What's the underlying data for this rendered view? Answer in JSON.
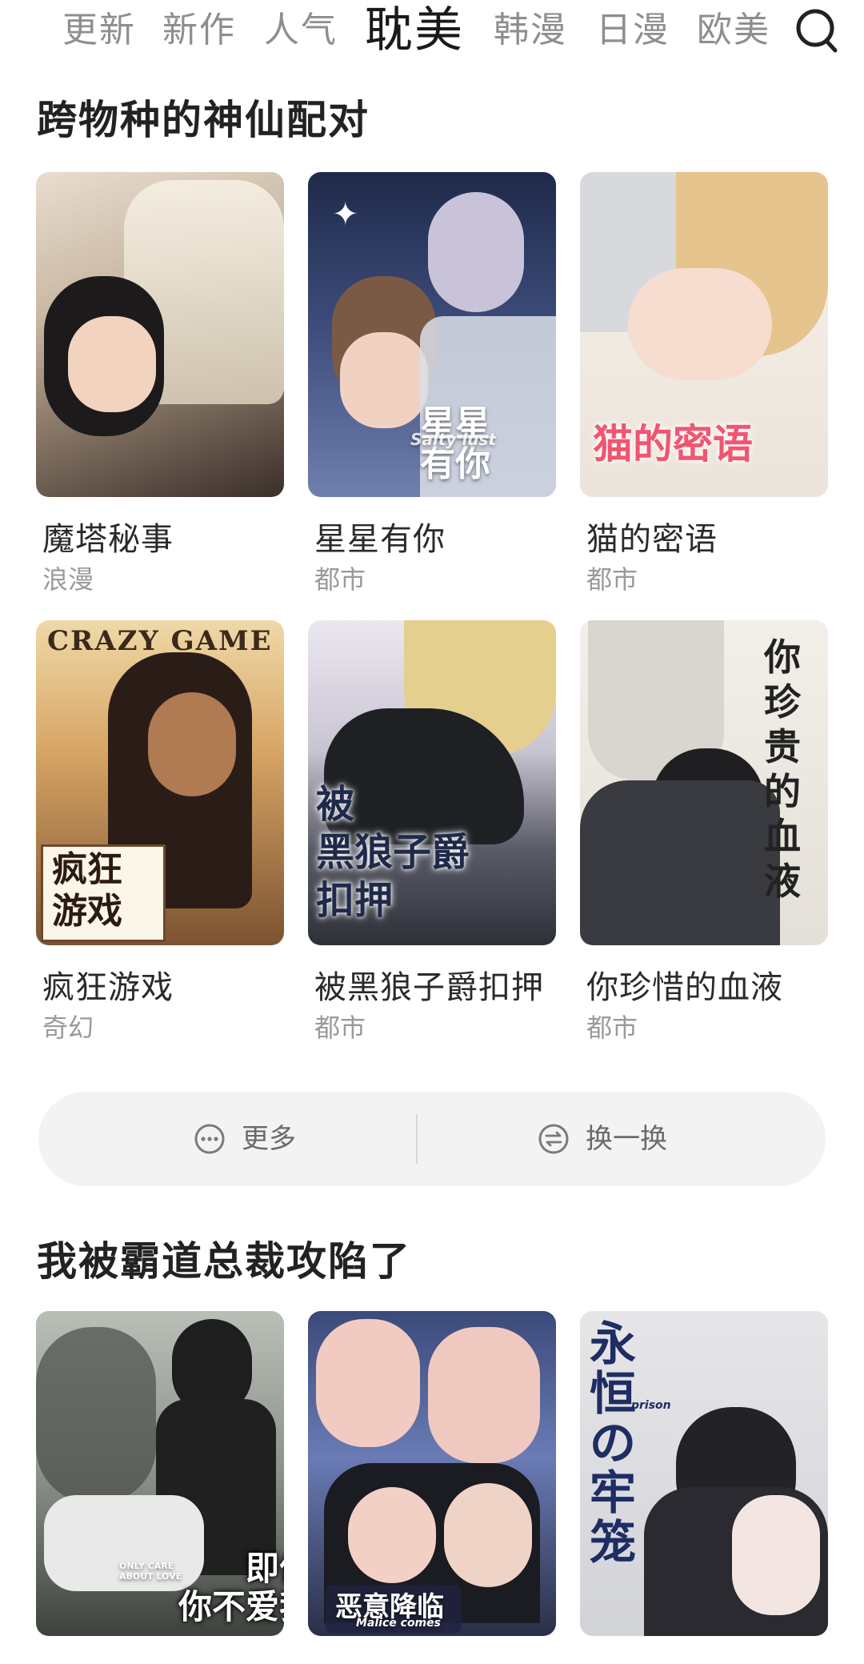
{
  "tabs": [
    "更新",
    "新作",
    "人气",
    "耽美",
    "韩漫",
    "日漫",
    "欧美"
  ],
  "active_tab": "耽美",
  "sections": [
    {
      "title": "跨物种的神仙配对",
      "items": [
        {
          "title": "魔塔秘事",
          "genre": "浪漫"
        },
        {
          "title": "星星有你",
          "genre": "都市",
          "cover_text": "星星\n有你",
          "cover_subtext": "Salty lust"
        },
        {
          "title": "猫的密语",
          "genre": "都市",
          "cover_text": "猫的密语"
        },
        {
          "title": "疯狂游戏",
          "genre": "奇幻",
          "cover_text": "疯狂\n游戏",
          "cover_subtext": "CRAZY GAME"
        },
        {
          "title": "被黑狼子爵扣押",
          "genre": "都市",
          "cover_text": "被\n黑狼子爵\n扣押"
        },
        {
          "title": "你珍惜的血液",
          "genre": "都市",
          "cover_text": "你珍贵的血液"
        }
      ]
    },
    {
      "title": "我被霸道总裁攻陷了",
      "items": [
        {
          "title": "即便你不爱我",
          "cover_text": "即便\n你不爱我",
          "cover_subtext": "ONLY CARE ABOUT LOVE"
        },
        {
          "title": "恶意降临",
          "cover_text": "恶意降临",
          "cover_subtext": "Malice comes"
        },
        {
          "title": "永恒的牢笼",
          "cover_text": "永恒の牢笼",
          "cover_subtext": "prison"
        }
      ]
    }
  ],
  "actions": {
    "more": "更多",
    "refresh": "换一换"
  },
  "icons": {
    "search": "search-icon",
    "more": "more-dots-icon",
    "refresh": "refresh-swap-icon"
  }
}
